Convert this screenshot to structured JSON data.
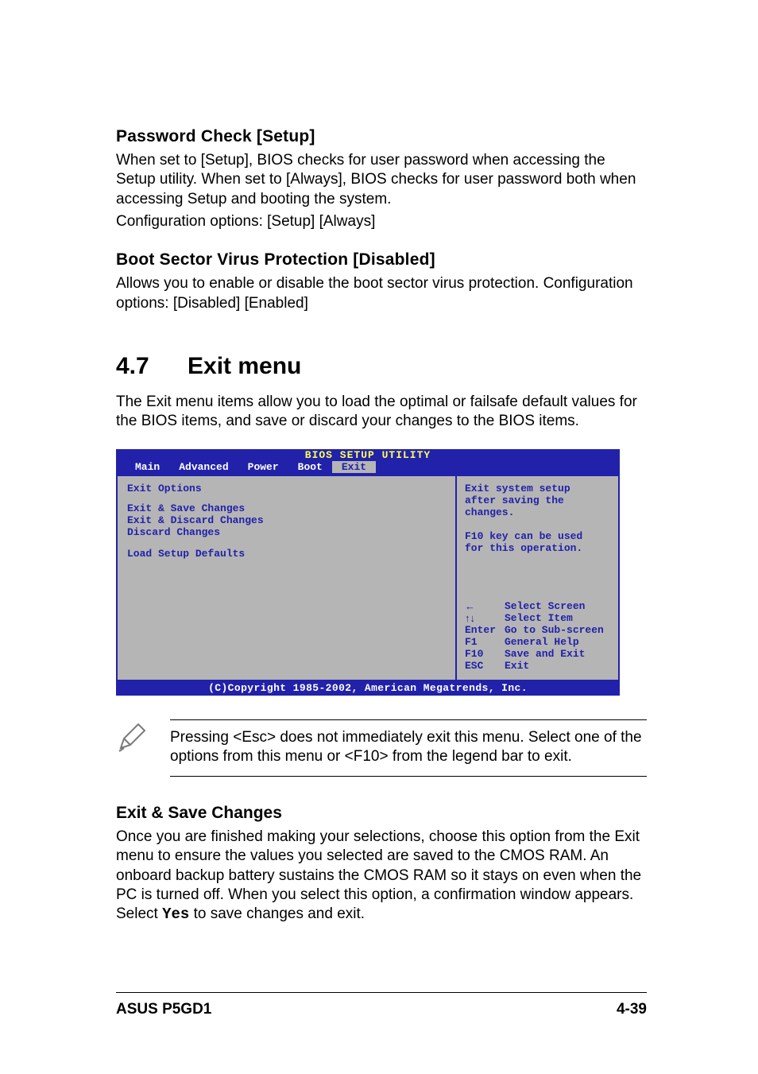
{
  "sections": {
    "passwordCheck": {
      "heading": "Password Check [Setup]",
      "body1": "When set to [Setup], BIOS checks for user password when accessing the Setup utility. When set to [Always], BIOS checks for user password both when accessing Setup and booting the system.",
      "body2": "Configuration options: [Setup] [Always]"
    },
    "bootSector": {
      "heading": "Boot Sector Virus Protection [Disabled]",
      "body1": "Allows you to enable or disable the boot sector virus protection. Configuration options: [Disabled] [Enabled]"
    },
    "exitMenu": {
      "num": "4.7",
      "title": "Exit menu",
      "intro": "The Exit menu items allow you to load the optimal or failsafe default values for the BIOS items, and save or discard your changes to the BIOS items."
    },
    "exitSave": {
      "heading": "Exit & Save Changes",
      "bodyA": "Once you are finished making your selections, choose this option from the Exit menu to ensure the values you selected are saved to the CMOS RAM. An onboard backup battery sustains the CMOS RAM so it stays on even when the PC is turned off. When you select this option, a confirmation window appears. Select ",
      "yes": "Yes",
      "bodyB": " to save changes and exit."
    }
  },
  "bios": {
    "title": "BIOS SETUP UTILITY",
    "tabs": [
      "Main",
      "Advanced",
      "Power",
      "Boot",
      "Exit"
    ],
    "activeTab": "Exit",
    "leftTitle": "Exit Options",
    "menuItems": [
      "Exit & Save Changes",
      "Exit & Discard Changes",
      "Discard Changes",
      "",
      "Load Setup Defaults"
    ],
    "helpTop": [
      "Exit system setup",
      "after saving the",
      "changes.",
      "",
      "F10 key can be used",
      "for this operation."
    ],
    "legend": [
      {
        "key": "←",
        "label": "Select Screen"
      },
      {
        "key": "↑↓",
        "label": "Select Item"
      },
      {
        "key": "Enter",
        "label": "Go to Sub-screen"
      },
      {
        "key": "F1",
        "label": "General Help"
      },
      {
        "key": "F10",
        "label": "Save and Exit"
      },
      {
        "key": "ESC",
        "label": "Exit"
      }
    ],
    "footer": "(C)Copyright 1985-2002, American Megatrends, Inc."
  },
  "note": {
    "text": "Pressing <Esc> does not immediately exit this menu. Select one of the options from this menu or <F10> from the legend bar to exit."
  },
  "footer": {
    "left": "ASUS P5GD1",
    "right": "4-39"
  },
  "icons": {
    "pencil": "pencil-icon"
  }
}
